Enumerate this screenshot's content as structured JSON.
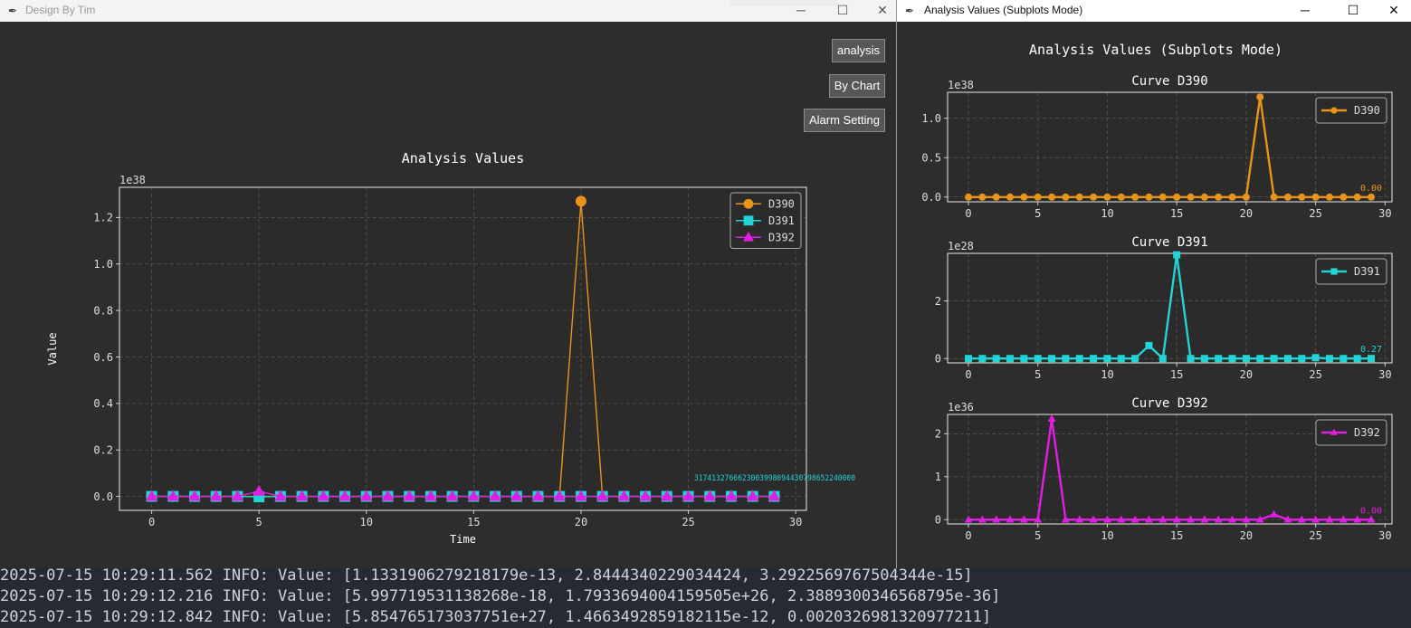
{
  "left_window": {
    "title": "Design By Tim",
    "buttons": {
      "analysis": "analysis",
      "by_chart": "By Chart",
      "alarm_setting": "Alarm Setting"
    }
  },
  "right_window": {
    "title": "Analysis Values (Subplots Mode)"
  },
  "window_controls": {
    "minimize": "─",
    "maximize": "☐",
    "close": "✕"
  },
  "colors": {
    "D390": "#e8931a",
    "D391": "#22d4d4",
    "D392": "#e31ee3",
    "background": "#2d2d2d",
    "plot_bg": "#2b2b2b"
  },
  "chart_data": [
    {
      "type": "line",
      "title": "Analysis Values",
      "xlabel": "Time",
      "ylabel": "Value",
      "offset_label": "1e38",
      "xlim": [
        -1.5,
        30.5
      ],
      "ylim": [
        -0.06,
        1.33
      ],
      "xticks": [
        0,
        5,
        10,
        15,
        20,
        25,
        30
      ],
      "yticks": [
        0.0,
        0.2,
        0.4,
        0.6,
        0.8,
        1.0,
        1.2
      ],
      "ytick_labels": [
        "0.0",
        "0.2",
        "0.4",
        "0.6",
        "0.8",
        "1.0",
        "1.2"
      ],
      "grid": true,
      "legend_position": "top-right",
      "overlapping_annotation": "3174132766623003998094430798652240000",
      "x": [
        0,
        1,
        2,
        3,
        4,
        5,
        6,
        7,
        8,
        9,
        10,
        11,
        12,
        13,
        14,
        15,
        16,
        17,
        18,
        19,
        20,
        21,
        22,
        23,
        24,
        25,
        26,
        27,
        28,
        29
      ],
      "series": [
        {
          "name": "D390",
          "marker": "circle",
          "values": [
            0,
            0,
            0,
            0,
            0,
            0,
            0,
            0,
            0,
            0,
            0,
            0,
            0,
            0,
            0,
            0,
            0,
            0,
            0,
            0,
            1.27,
            0,
            0,
            0,
            0,
            0,
            0,
            0,
            0,
            0
          ]
        },
        {
          "name": "D391",
          "marker": "square",
          "values": [
            0,
            0,
            0,
            0,
            0,
            -0.002,
            0,
            0,
            0,
            0,
            0,
            0,
            0,
            0,
            0,
            0,
            0,
            0,
            0,
            0,
            0,
            0,
            0,
            0,
            0,
            0,
            0,
            0,
            0,
            0
          ]
        },
        {
          "name": "D392",
          "marker": "triangle",
          "values": [
            0,
            0,
            0,
            0,
            0,
            0.022,
            0,
            0,
            0,
            0,
            0,
            0,
            0,
            0,
            0,
            0,
            0,
            0,
            0,
            0,
            0,
            0,
            0,
            0,
            0,
            0,
            0,
            0,
            0,
            0
          ]
        }
      ]
    },
    {
      "type": "line",
      "suptitle": "Analysis Values (Subplots Mode)",
      "title": "Curve D390",
      "offset_label": "1e38",
      "xlim": [
        -1.5,
        30.5
      ],
      "ylim": [
        -0.06,
        1.33
      ],
      "xticks": [
        0,
        5,
        10,
        15,
        20,
        25,
        30
      ],
      "yticks": [
        0.0,
        0.5,
        1.0
      ],
      "ytick_labels": [
        "0.0",
        "0.5",
        "1.0"
      ],
      "grid": true,
      "legend_position": "top-right",
      "last_value_label": "0.00",
      "x": [
        0,
        1,
        2,
        3,
        4,
        5,
        6,
        7,
        8,
        9,
        10,
        11,
        12,
        13,
        14,
        15,
        16,
        17,
        18,
        19,
        20,
        21,
        22,
        23,
        24,
        25,
        26,
        27,
        28,
        29
      ],
      "series": [
        {
          "name": "D390",
          "marker": "circle",
          "values": [
            0,
            0,
            0,
            0,
            0,
            0,
            0,
            0,
            0,
            0,
            0,
            0,
            0,
            0,
            0,
            0,
            0,
            0,
            0,
            0,
            0,
            1.27,
            0,
            0,
            0,
            0,
            0,
            0,
            0,
            0
          ]
        }
      ]
    },
    {
      "type": "line",
      "title": "Curve D391",
      "offset_label": "1e28",
      "xlim": [
        -1.5,
        30.5
      ],
      "ylim": [
        -0.15,
        3.65
      ],
      "xticks": [
        0,
        5,
        10,
        15,
        20,
        25,
        30
      ],
      "yticks": [
        0,
        2
      ],
      "ytick_labels": [
        "0",
        "2"
      ],
      "grid": true,
      "legend_position": "top-right",
      "last_value_label": "0.27",
      "x": [
        0,
        1,
        2,
        3,
        4,
        5,
        6,
        7,
        8,
        9,
        10,
        11,
        12,
        13,
        14,
        15,
        16,
        17,
        18,
        19,
        20,
        21,
        22,
        23,
        24,
        25,
        26,
        27,
        28,
        29
      ],
      "series": [
        {
          "name": "D391",
          "marker": "square",
          "values": [
            0,
            0,
            0,
            0,
            0,
            0,
            0,
            0,
            0,
            0,
            0,
            0,
            0,
            0.45,
            0,
            3.6,
            0,
            0,
            0,
            0,
            0,
            0,
            0,
            0,
            0,
            0.03,
            0,
            0,
            0,
            0
          ]
        }
      ]
    },
    {
      "type": "line",
      "title": "Curve D392",
      "offset_label": "1e36",
      "xlim": [
        -1.5,
        30.5
      ],
      "ylim": [
        -0.1,
        2.45
      ],
      "xticks": [
        0,
        5,
        10,
        15,
        20,
        25,
        30
      ],
      "yticks": [
        0,
        1,
        2
      ],
      "ytick_labels": [
        "0",
        "1",
        "2"
      ],
      "grid": true,
      "legend_position": "top-right",
      "last_value_label": "0.00",
      "x": [
        0,
        1,
        2,
        3,
        4,
        5,
        6,
        7,
        8,
        9,
        10,
        11,
        12,
        13,
        14,
        15,
        16,
        17,
        18,
        19,
        20,
        21,
        22,
        23,
        24,
        25,
        26,
        27,
        28,
        29
      ],
      "series": [
        {
          "name": "D392",
          "marker": "triangle",
          "values": [
            0,
            0,
            0,
            0,
            0,
            0,
            2.35,
            0,
            0,
            0,
            0,
            0,
            0,
            0,
            0,
            0,
            0,
            0,
            0,
            0,
            0,
            0,
            0.12,
            0,
            0,
            0,
            0,
            0,
            0,
            0
          ]
        }
      ]
    }
  ],
  "console": {
    "lines": [
      "2025-07-15 10:29:11.562 INFO: Value: [1.1331906279218179e-13, 2.8444340229034424, 3.2922569767504344e-15]",
      "2025-07-15 10:29:12.216 INFO: Value: [5.997719531138268e-18, 1.7933694004159505e+26, 2.3889300346568795e-36]",
      "2025-07-15 10:29:12.842 INFO: Value: [5.854765173037751e+27, 1.4663492859182115e-12, 0.0020326981320977211]"
    ]
  }
}
